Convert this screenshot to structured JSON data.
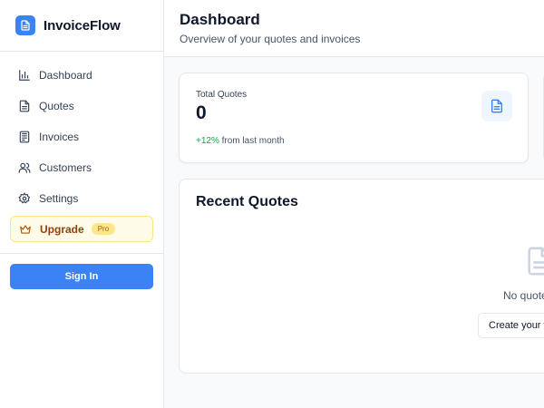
{
  "app": {
    "name": "InvoiceFlow",
    "accent": "#3b82f6"
  },
  "sidebar": {
    "items": [
      {
        "label": "Dashboard",
        "icon": "bar-chart-icon"
      },
      {
        "label": "Quotes",
        "icon": "document-icon"
      },
      {
        "label": "Invoices",
        "icon": "receipt-icon"
      },
      {
        "label": "Customers",
        "icon": "users-icon"
      },
      {
        "label": "Settings",
        "icon": "gear-icon"
      }
    ],
    "upgrade": {
      "label": "Upgrade",
      "badge": "Pro",
      "icon": "crown-icon"
    },
    "signin_label": "Sign In"
  },
  "header": {
    "title": "Dashboard",
    "subtitle": "Overview of your quotes and invoices"
  },
  "stats": {
    "total_quotes": {
      "label": "Total Quotes",
      "value": "0",
      "change": "+12%",
      "change_suffix": "from last month",
      "icon": "document-icon"
    }
  },
  "recent_quotes": {
    "title": "Recent Quotes",
    "empty_text": "No quote",
    "create_label": "Create your f",
    "icon": "document-icon"
  }
}
